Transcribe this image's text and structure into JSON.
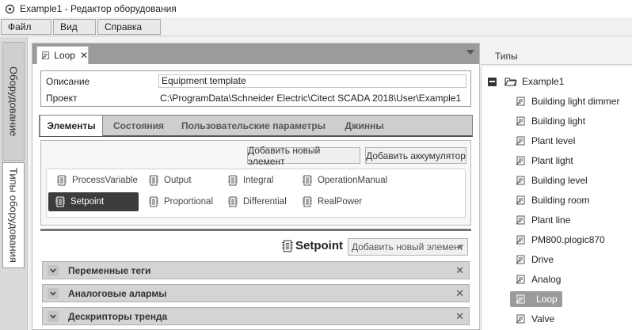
{
  "window": {
    "title": "Example1 - Редактор оборудования"
  },
  "menu": [
    "Файл",
    "Вид",
    "Справка"
  ],
  "sidebar": {
    "tabs": [
      "Оборудование",
      "Типы оборудования"
    ]
  },
  "document": {
    "tab_label": "Loop",
    "info": {
      "description_label": "Описание",
      "description_value": "Equipment template",
      "project_label": "Проект",
      "project_value": "C:\\ProgramData\\Schneider Electric\\Citect SCADA 2018\\User\\Example1"
    },
    "tabs": [
      "Элементы",
      "Состояния",
      "Пользовательские параметры",
      "Джинны"
    ],
    "buttons": {
      "add_element": "Добавить новый элемент",
      "add_accumulator": "Добавить аккумулятор"
    },
    "items": [
      "ProcessVariable",
      "Output",
      "Integral",
      "OperationManual",
      "Setpoint",
      "Proportional",
      "Differential",
      "RealPower"
    ],
    "selected": {
      "title": "Setpoint",
      "add_dropdown": "Добавить новый элемент"
    },
    "sections": [
      "Переменные теги",
      "Аналоговые алармы",
      "Дескрипторы тренда"
    ]
  },
  "types_panel": {
    "header": "Типы",
    "root": "Example1",
    "items": [
      "Building light dimmer",
      "Building light",
      "Plant level",
      "Plant light",
      "Building level",
      "Building room",
      "Plant line",
      "PM800.plogic870",
      "Drive",
      "Analog",
      "Loop",
      "Valve"
    ],
    "selected": "Loop"
  },
  "colors": {
    "selected_item": "#3c3c3c",
    "selected_tree": "#9b9b9b",
    "header_gray": "#9b9b9b"
  }
}
